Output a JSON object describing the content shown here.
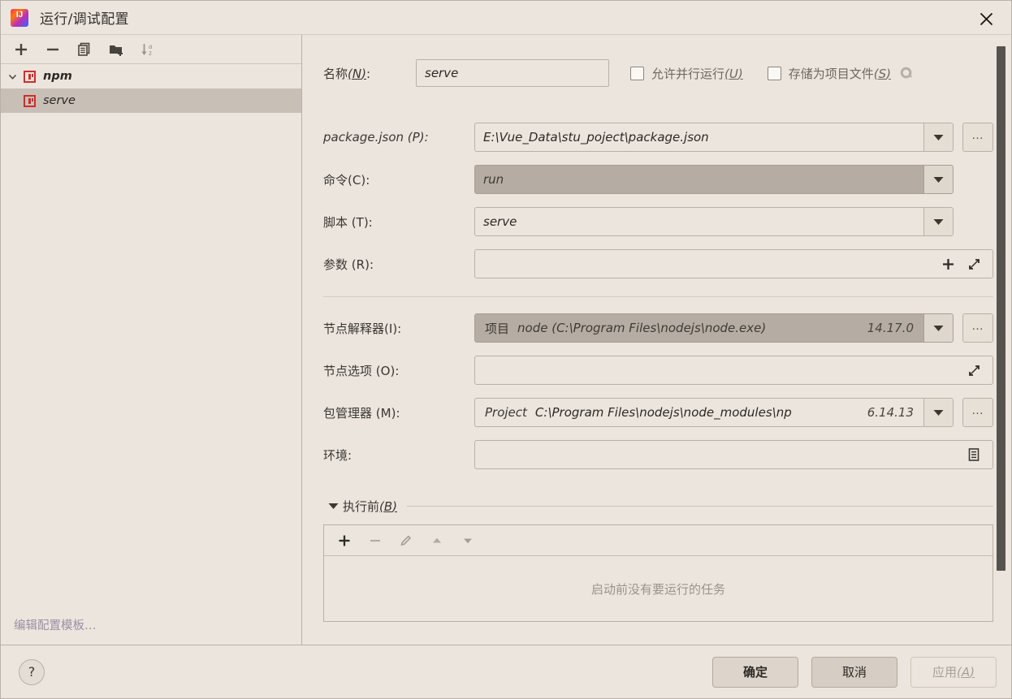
{
  "window": {
    "title": "运行/调试配置",
    "app_icon": "intellij-idea-icon",
    "close_icon": "close-icon"
  },
  "left_panel": {
    "toolbar": [
      {
        "name": "add-configuration-button",
        "icon": "plus-icon",
        "label": "+"
      },
      {
        "name": "remove-configuration-button",
        "icon": "minus-icon",
        "label": "−"
      },
      {
        "name": "copy-configuration-button",
        "icon": "copy-icon",
        "label": ""
      },
      {
        "name": "new-folder-button",
        "icon": "new-folder-icon",
        "label": ""
      },
      {
        "name": "sort-configurations-button",
        "icon": "sort-alphabetical-icon",
        "label": ""
      }
    ],
    "tree": [
      {
        "label": "npm",
        "icon": "npm-icon",
        "expanded": true,
        "selected": false,
        "level": 0
      },
      {
        "label": "serve",
        "icon": "npm-icon",
        "expanded": false,
        "selected": true,
        "level": 1
      }
    ],
    "edit_templates_link": "编辑配置模板…"
  },
  "form": {
    "name": {
      "label_text": "名称",
      "mnemonic": "N",
      "suffix": ":",
      "value": "serve"
    },
    "allow_parallel": {
      "label_text": "允许并行运行",
      "mnemonic": "U",
      "checked": false
    },
    "store_as_project_file": {
      "label_text": "存储为项目文件",
      "mnemonic": "S",
      "checked": false,
      "gear_icon": "gear-icon"
    },
    "package_json": {
      "label_text": "package.json ",
      "mnemonic": "P",
      "suffix": ":",
      "value": "E:\\Vue_Data\\stu_poject\\package.json",
      "browse_label": "…"
    },
    "command": {
      "label_text": "命令",
      "mnemonic": "C",
      "suffix": ":",
      "value": "run",
      "highlighted": true
    },
    "scripts": {
      "label_text": "脚本 ",
      "mnemonic": "T",
      "suffix": ":",
      "value": "serve"
    },
    "arguments": {
      "label_text": "参数 ",
      "mnemonic": "R",
      "suffix": ":",
      "value": "",
      "add_icon": "plus-icon",
      "expand_icon": "expand-diagonal-icon"
    },
    "node_interpreter": {
      "label_text": "节点解释器",
      "mnemonic": "I",
      "suffix": ":",
      "prefix": "项目",
      "value": "node (C:\\Program Files\\nodejs\\node.exe)",
      "version": "14.17.0",
      "highlighted": true,
      "browse_label": "…"
    },
    "node_options": {
      "label_text": "节点选项 ",
      "mnemonic": "O",
      "suffix": ":",
      "value": "",
      "expand_icon": "expand-diagonal-icon"
    },
    "package_manager": {
      "label_text": "包管理器 ",
      "mnemonic": "M",
      "suffix": ":",
      "prefix": "Project",
      "value": "C:\\Program Files\\nodejs\\node_modules\\np",
      "version": "6.14.13",
      "browse_label": "…"
    },
    "environment": {
      "label_text": "环境:",
      "value": "",
      "edit_icon": "environment-variables-icon"
    }
  },
  "before_launch": {
    "label_text": "执行前",
    "mnemonic": "B",
    "expanded": true,
    "toolbar": [
      {
        "name": "add-task-button",
        "icon": "plus-icon",
        "enabled": true
      },
      {
        "name": "remove-task-button",
        "icon": "minus-icon",
        "enabled": false
      },
      {
        "name": "edit-task-button",
        "icon": "pencil-icon",
        "enabled": false
      },
      {
        "name": "move-task-up-button",
        "icon": "arrow-up-icon",
        "enabled": false
      },
      {
        "name": "move-task-down-button",
        "icon": "arrow-down-icon",
        "enabled": false
      }
    ],
    "empty_text": "启动前没有要运行的任务"
  },
  "footer": {
    "help_label": "?",
    "ok_label": "确定",
    "cancel_label": "取消",
    "apply_label_text": "应用",
    "apply_mnemonic": "A"
  },
  "colors": {
    "background": "#ece5dd",
    "border": "#b9b1a7",
    "selection": "#c8c0b6",
    "field_highlight": "#b5ada3",
    "link": "#9b8fa6",
    "npm_red": "#d22b2b",
    "scrollbar_thumb": "#56534f"
  }
}
